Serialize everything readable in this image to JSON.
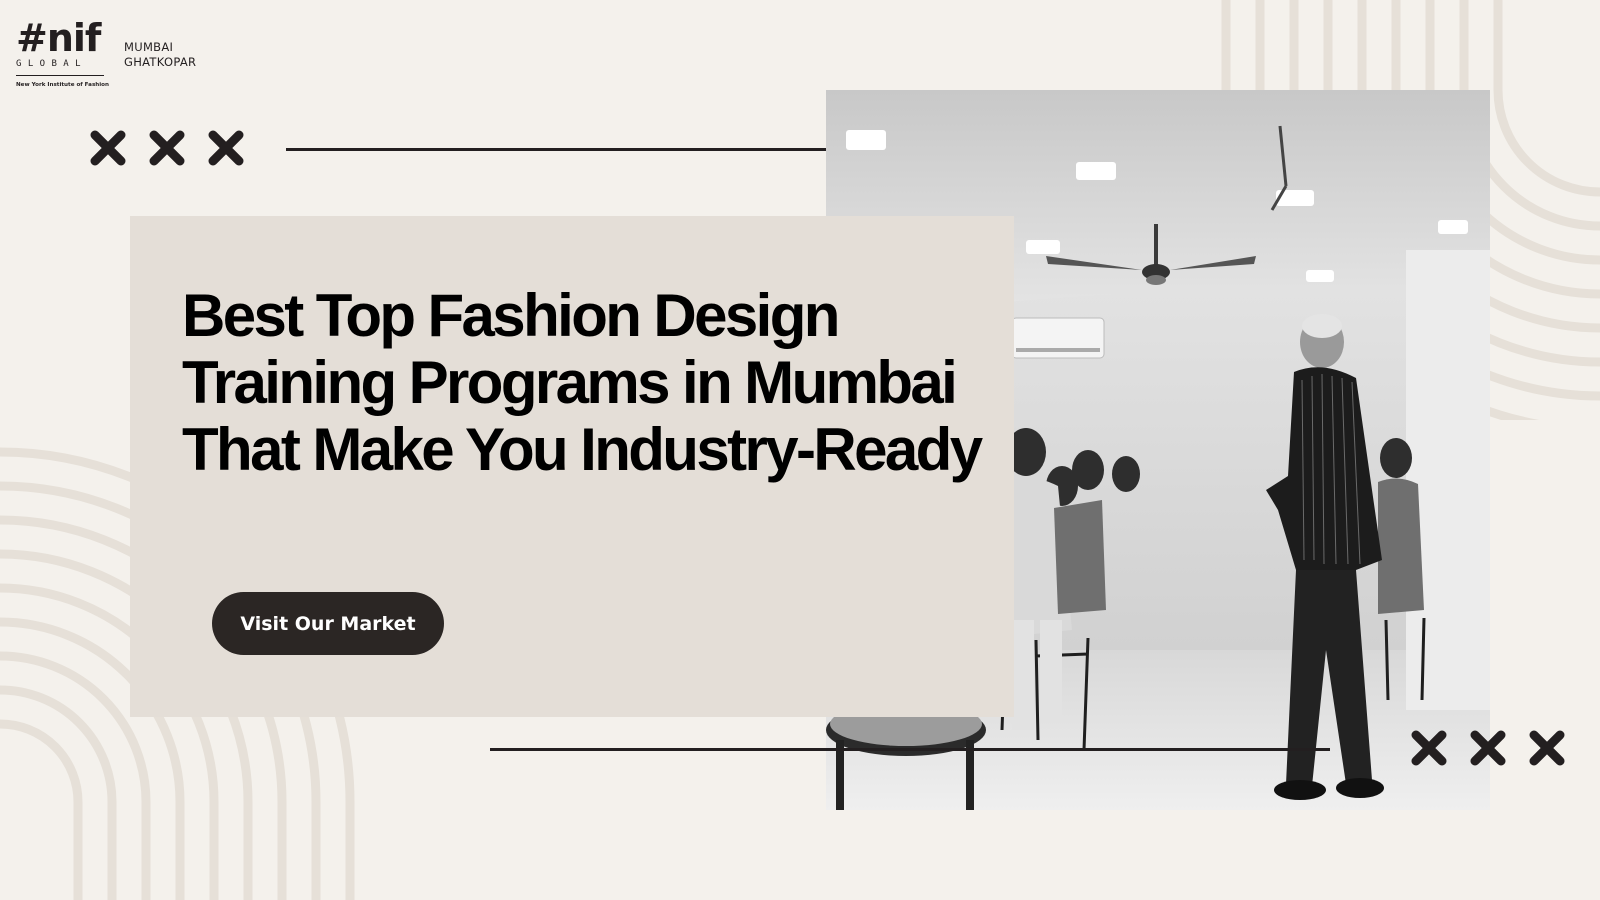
{
  "brand": {
    "logo_mark": "#nif",
    "logo_sub": "GLOBAL",
    "logo_tagline": "New York Institute of Fashion",
    "location_line1": "MUMBAI",
    "location_line2": "GHATKOPAR"
  },
  "hero": {
    "headline": "Best Top Fashion Design Training Programs in Mumbai That Make You Industry-Ready",
    "cta_label": "Visit Our Market"
  },
  "colors": {
    "background": "#f4f1ec",
    "card": "#e4ded7",
    "dark": "#231f20",
    "button": "#2b2624",
    "decorative_arcs": "#e6e0d8"
  },
  "photo": {
    "style": "black-and-white",
    "subject": "classroom-seminar"
  }
}
